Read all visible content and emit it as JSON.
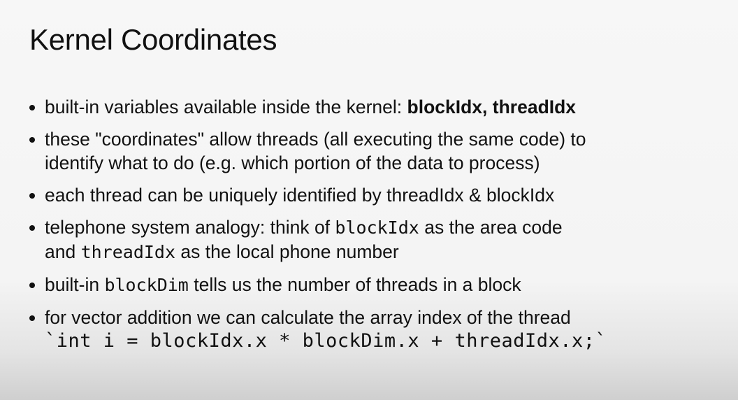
{
  "slide": {
    "title": "Kernel Coordinates",
    "bullets": [
      {
        "lines": [
          {
            "text": "built-in variables available inside the kernel: ",
            "bold_1": "blockIdx",
            "sep": ", ",
            "bold_2": "threadIdx"
          }
        ]
      },
      {
        "lines": [
          {
            "text": "these \"coordinates\" allow threads (all executing the same code) to"
          },
          {
            "text": "identify what to do (e.g. which portion of the data to process)"
          }
        ]
      },
      {
        "lines": [
          {
            "text": "each thread can be uniquely identified by threadIdx & blockIdx"
          }
        ]
      },
      {
        "lines": [
          {
            "pre": "telephone system analogy: think of ",
            "code": "blockIdx",
            "post": " as the area code"
          },
          {
            "pre": "and ",
            "code": "threadIdx",
            "post": " as the local phone number"
          }
        ]
      },
      {
        "lines": [
          {
            "pre": "built-in ",
            "code": "blockDim",
            "post": " tells us the number of threads in a block"
          }
        ]
      },
      {
        "lines": [
          {
            "text": "for vector addition we can calculate the array index of the thread"
          },
          {
            "code": "`int i = blockIdx.x * blockDim.x + threadIdx.x;`"
          }
        ]
      }
    ]
  }
}
